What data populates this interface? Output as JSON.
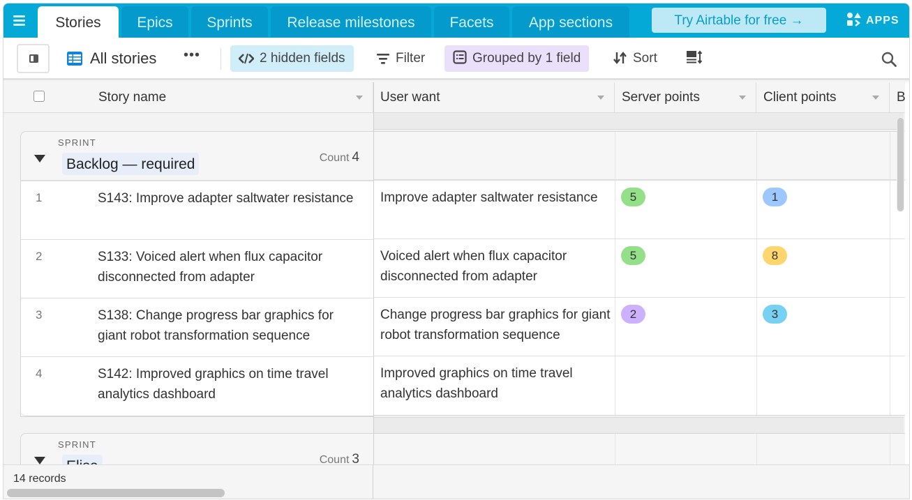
{
  "tabs": [
    {
      "label": "Stories",
      "active": true
    },
    {
      "label": "Epics",
      "active": false
    },
    {
      "label": "Sprints",
      "active": false
    },
    {
      "label": "Release milestones",
      "active": false
    },
    {
      "label": "Facets",
      "active": false
    },
    {
      "label": "App sections",
      "active": false
    }
  ],
  "try_button": "Try Airtable for free →",
  "apps_label": "APPS",
  "toolbar": {
    "view_name": "All stories",
    "more": "•••",
    "hidden_fields": "2 hidden fields",
    "filter": "Filter",
    "grouped": "Grouped by 1 field",
    "sort": "Sort"
  },
  "columns": [
    {
      "label": "Story name"
    },
    {
      "label": "User want"
    },
    {
      "label": "Server points"
    },
    {
      "label": "Client points"
    },
    {
      "label": "Bu"
    }
  ],
  "groups": [
    {
      "field": "SPRINT",
      "value": "Backlog — required",
      "count_label": "Count",
      "count": "4",
      "rows": [
        {
          "num": "1",
          "name": "S143: Improve adapter saltwater resistance",
          "want": "Improve adapter saltwater resistance",
          "server": "5",
          "client": "1"
        },
        {
          "num": "2",
          "name": "S133: Voiced alert when flux capacitor disconnected from adapter",
          "want": "Voiced alert when flux capacitor disconnected from adapter",
          "server": "5",
          "client": "8"
        },
        {
          "num": "3",
          "name": "S138: Change progress bar graphics for giant robot transformation sequence",
          "want": "Change progress bar graphics for giant robot transformation sequence",
          "server": "2",
          "client": "3"
        },
        {
          "num": "4",
          "name": "S142: Improved graphics on time travel analytics dashboard",
          "want": "Improved graphics on time travel analytics dashboard",
          "server": "",
          "client": ""
        }
      ]
    },
    {
      "field": "SPRINT",
      "value": "Elise",
      "count_label": "Count",
      "count": "3"
    }
  ],
  "point_colors": {
    "1": "#9cc7ff",
    "2": "#cdb0ff",
    "3": "#77d1f3",
    "5": "#93e088",
    "8": "#ffd66e"
  },
  "footer": {
    "records": "14 records"
  }
}
